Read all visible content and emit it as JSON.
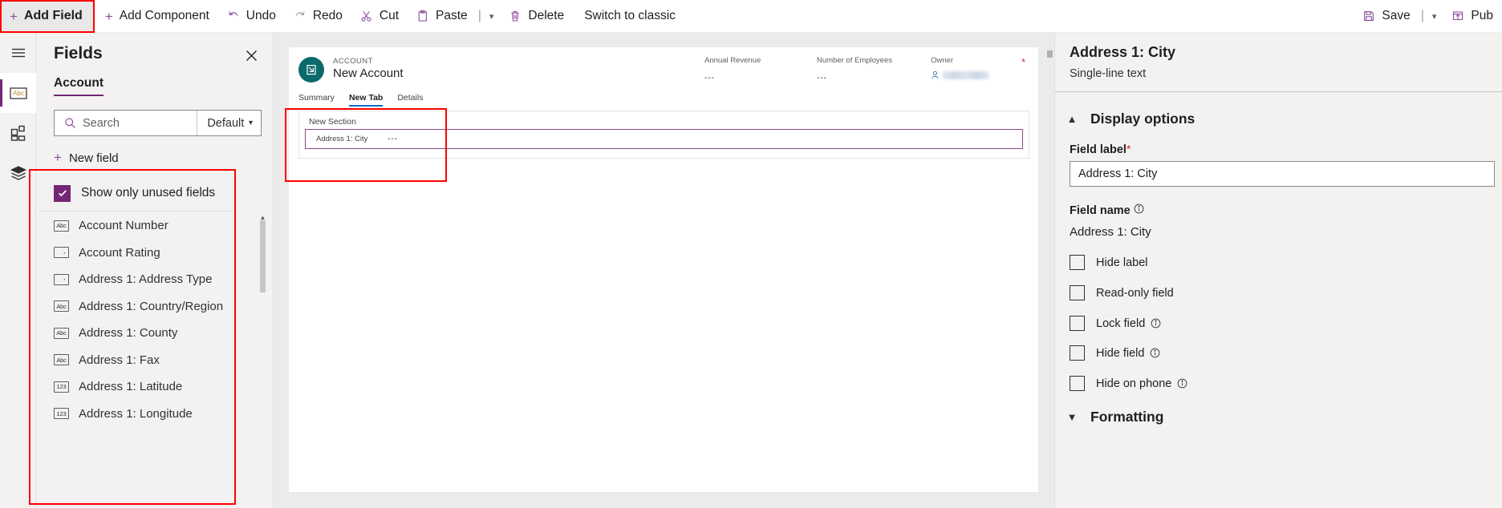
{
  "toolbar": {
    "add_field": "Add Field",
    "add_component": "Add Component",
    "undo": "Undo",
    "redo": "Redo",
    "cut": "Cut",
    "paste": "Paste",
    "delete": "Delete",
    "switch_to_classic": "Switch to classic",
    "save": "Save",
    "publish": "Pub"
  },
  "rail": {
    "items": [
      {
        "icon": "hamburger-menu-icon",
        "active": false
      },
      {
        "icon": "fields-abc-icon",
        "active": true
      },
      {
        "icon": "components-grid-icon",
        "active": false
      },
      {
        "icon": "layers-stack-icon",
        "active": false
      }
    ]
  },
  "fields_panel": {
    "title": "Fields",
    "tab": "Account",
    "search_placeholder": "Search",
    "search_value": "",
    "filter_selected": "Default",
    "new_field": "New field",
    "show_only_unused": "Show only unused fields",
    "show_only_unused_checked": true,
    "list": [
      {
        "label": "Account Number",
        "type": "text"
      },
      {
        "label": "Account Rating",
        "type": "choice"
      },
      {
        "label": "Address 1: Address Type",
        "type": "choice"
      },
      {
        "label": "Address 1: Country/Region",
        "type": "text"
      },
      {
        "label": "Address 1: County",
        "type": "text"
      },
      {
        "label": "Address 1: Fax",
        "type": "text"
      },
      {
        "label": "Address 1: Latitude",
        "type": "number"
      },
      {
        "label": "Address 1: Longitude",
        "type": "number"
      }
    ],
    "icon_text": "Abc",
    "icon_number": "123"
  },
  "canvas": {
    "entity_label": "ACCOUNT",
    "record_name": "New Account",
    "header_fields": [
      {
        "label": "Annual Revenue",
        "value": "---"
      },
      {
        "label": "Number of Employees",
        "value": "---"
      },
      {
        "label": "Owner",
        "value": "",
        "required": true
      }
    ],
    "tabs": [
      {
        "label": "Summary",
        "active": false
      },
      {
        "label": "New Tab",
        "active": true
      },
      {
        "label": "Details",
        "active": false
      }
    ],
    "section_label": "New Section",
    "selected_field": {
      "label": "Address 1: City",
      "value": "---"
    }
  },
  "properties": {
    "title": "Address 1: City",
    "subtitle": "Single-line text",
    "display_options": "Display options",
    "display_options_expanded": true,
    "field_label_caption": "Field label",
    "field_label_required": "*",
    "field_label_value": "Address 1: City",
    "field_name_caption": "Field name",
    "field_name_value": "Address 1: City",
    "checkboxes": [
      {
        "label": "Hide label",
        "checked": false,
        "info": false
      },
      {
        "label": "Read-only field",
        "checked": false,
        "info": false
      },
      {
        "label": "Lock field",
        "checked": false,
        "info": true
      },
      {
        "label": "Hide field",
        "checked": false,
        "info": true
      },
      {
        "label": "Hide on phone",
        "checked": false,
        "info": true
      }
    ],
    "formatting": "Formatting",
    "formatting_expanded": false
  },
  "colors": {
    "accent_purple": "#742774",
    "icon_purple": "#8c4e9c",
    "tab_blue": "#0f6cbd",
    "required_red": "#d13438",
    "highlight_red": "#ff0000",
    "entity_teal": "#0b6a6a"
  }
}
